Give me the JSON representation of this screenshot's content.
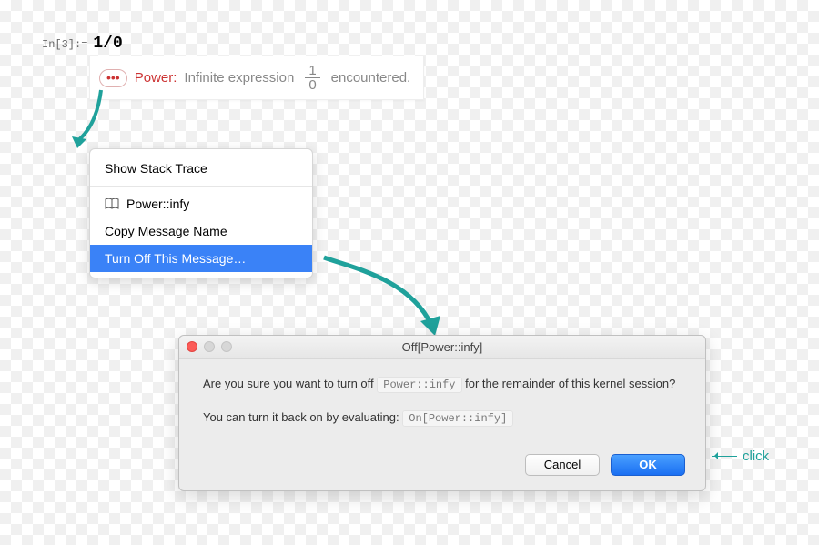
{
  "notebook": {
    "in_label": "In[3]:=",
    "in_expr": "1/0"
  },
  "message": {
    "tag": "Power:",
    "text_before": "Infinite expression",
    "fraction_num": "1",
    "fraction_den": "0",
    "text_after": "encountered."
  },
  "menu": {
    "show_stack": "Show Stack Trace",
    "symbol": "Power::infy",
    "copy_name": "Copy Message Name",
    "turn_off": "Turn Off This Message…"
  },
  "dialog": {
    "title": "Off[Power::infy]",
    "line1_a": "Are you sure you want to turn off",
    "line1_chip": "Power::infy",
    "line1_b": "for the remainder of this kernel session?",
    "line2_a": "You can turn it back on by evaluating:",
    "line2_chip": "On[Power::infy]",
    "cancel": "Cancel",
    "ok": "OK"
  },
  "annotation": {
    "click": "click"
  }
}
